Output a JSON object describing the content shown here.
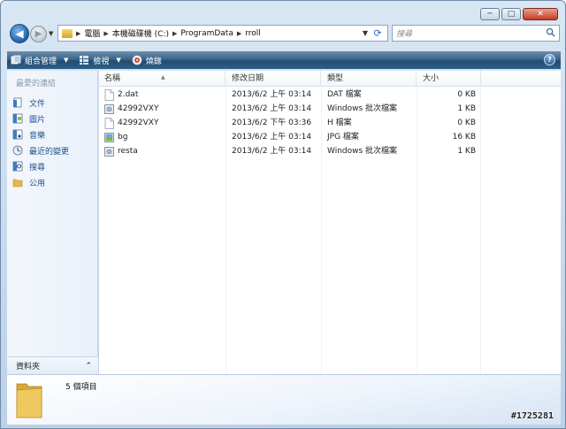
{
  "window": {
    "minimize_glyph": "─",
    "maximize_glyph": "□",
    "close_glyph": "✕"
  },
  "address": {
    "crumbs": [
      "電腦",
      "本機磁碟機 (C:)",
      "ProgramData",
      "rroll"
    ],
    "search_placeholder": "搜尋"
  },
  "toolbar": {
    "organize_label": "組合管理",
    "views_label": "檢視",
    "burn_label": "燒錄",
    "help_glyph": "?"
  },
  "sidebar": {
    "header": "最愛的連結",
    "items": [
      {
        "label": "文件",
        "icon": "documents-icon"
      },
      {
        "label": "圖片",
        "icon": "pictures-icon"
      },
      {
        "label": "音樂",
        "icon": "music-icon"
      },
      {
        "label": "最近的變更",
        "icon": "recent-changes-icon"
      },
      {
        "label": "搜尋",
        "icon": "searches-icon"
      },
      {
        "label": "公用",
        "icon": "public-folder-icon"
      }
    ],
    "folders_label": "資料夾"
  },
  "columns": {
    "name": "名稱",
    "date": "修改日期",
    "type": "類型",
    "size": "大小"
  },
  "files": [
    {
      "name": "2.dat",
      "date": "2013/6/2 上午 03:14",
      "type": "DAT 檔案",
      "size": "0 KB",
      "icon": "blank-file-icon"
    },
    {
      "name": "42992VXY",
      "date": "2013/6/2 上午 03:14",
      "type": "Windows 批次檔案",
      "size": "1 KB",
      "icon": "batch-file-icon"
    },
    {
      "name": "42992VXY",
      "date": "2013/6/2 下午 03:36",
      "type": "H 檔案",
      "size": "0 KB",
      "icon": "blank-file-icon"
    },
    {
      "name": "bg",
      "date": "2013/6/2 上午 03:14",
      "type": "JPG 檔案",
      "size": "16 KB",
      "icon": "image-file-icon"
    },
    {
      "name": "resta",
      "date": "2013/6/2 上午 03:14",
      "type": "Windows 批次檔案",
      "size": "1 KB",
      "icon": "batch-file-icon"
    }
  ],
  "details": {
    "item_count": "5 個項目"
  },
  "watermark": "#1725281",
  "colors": {
    "toolbar": "#2f5f88",
    "link": "#1c4f8c",
    "folder": "#e6b84a"
  }
}
